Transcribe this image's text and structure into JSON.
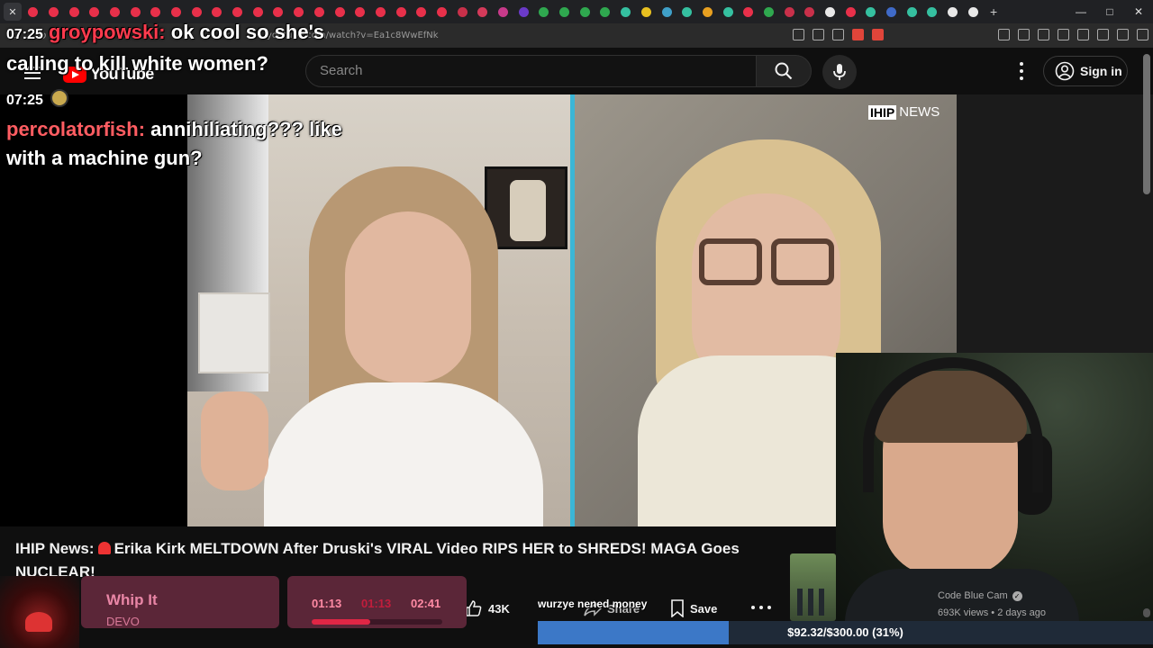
{
  "browser": {
    "url": "youtube.com/watch?v=Ea1c8WwEfNk",
    "tab_colors": [
      "#e8e8e8",
      "#e8304a",
      "#e8304a",
      "#e8304a",
      "#e8304a",
      "#e8304a",
      "#e8304a",
      "#e8304a",
      "#e8304a",
      "#e8304a",
      "#e8304a",
      "#e8304a",
      "#e8304a",
      "#e8304a",
      "#e8304a",
      "#e8304a",
      "#e8304a",
      "#e8304a",
      "#e8304a",
      "#e8304a",
      "#e8304a",
      "#e8304a",
      "#c8304a",
      "#d43a5a",
      "#c83a8a",
      "#6a3ac8",
      "#2fa84f",
      "#2fa84f",
      "#2fa84f",
      "#2fa84f",
      "#35c0a0",
      "#e8c020",
      "#3fa0c8",
      "#35c0a0",
      "#e8a020",
      "#35c0a0",
      "#e8304a",
      "#2fa84f",
      "#c8304a",
      "#c8304a",
      "#e8e8e8",
      "#e8304a",
      "#35c0a0",
      "#3f6ac8",
      "#35c0a0",
      "#35c0a0",
      "#e8e8e8",
      "#e8e8e8"
    ]
  },
  "youtube": {
    "logo_text": "YouTube",
    "search_placeholder": "Search",
    "signin_label": "Sign in",
    "watermark_box": "IHIP",
    "watermark_word": "NEWS"
  },
  "chat": {
    "messages": [
      {
        "time": "07:25",
        "user": "groypowski:",
        "text": "ok cool so she's",
        "text2": "calling to kill white women?"
      },
      {
        "time": "07:25",
        "user": "percolatorfish:",
        "text": "annihiliating??? like",
        "text2": "with a machine gun?"
      }
    ]
  },
  "video": {
    "title_prefix": "IHIP News:",
    "title_main": "Erika Kirk MELTDOWN After Druski's VIRAL Video RIPS HER to SHREDS! MAGA Goes NUCLEAR!",
    "likes": "43K",
    "share_label": "Share",
    "save_label": "Save",
    "donation_name": "wurzye nened money"
  },
  "recommendation": {
    "channel": "Code Blue Cam",
    "meta": "693K views • 2 days ago"
  },
  "now_playing": {
    "title": "Whip It",
    "artist": "DEVO",
    "current": "01:13",
    "mid": "01:13",
    "total": "02:41",
    "progress": 0.45
  },
  "goal": {
    "text": "$92.32/$300.00 (31%)",
    "fraction": 0.31,
    "colors": {
      "fill": "#3c78c7",
      "background": "#1f2a38"
    }
  }
}
